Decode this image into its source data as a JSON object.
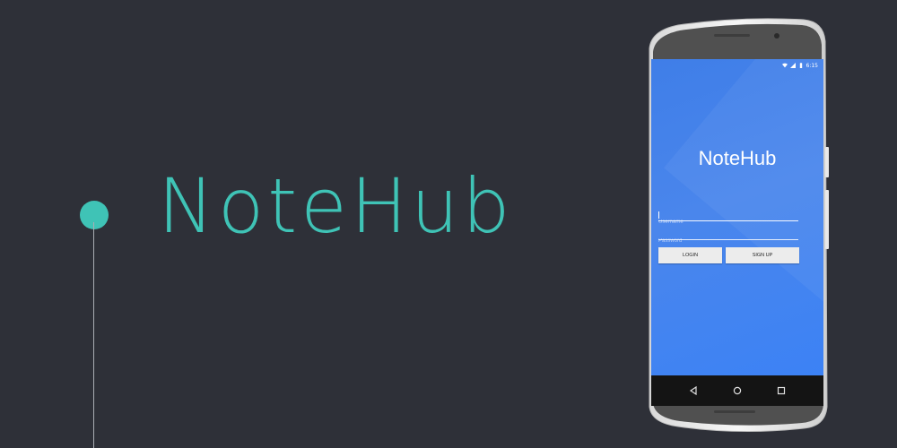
{
  "brand": {
    "title": "NoteHub",
    "accent_color": "#3fc3b6",
    "background_color": "#2e3038"
  },
  "phone": {
    "status_bar": {
      "icons": [
        "wifi-icon",
        "signal-icon",
        "battery-icon"
      ],
      "time": "6:15"
    },
    "app": {
      "title": "NoteHub",
      "username_placeholder": "Username",
      "password_placeholder": "Password",
      "login_label": "LOGIN",
      "signup_label": "SIGN UP",
      "screen_color": "#3f7ee8"
    },
    "nav_bar": {
      "icons": [
        "back-icon",
        "home-icon",
        "recents-icon"
      ]
    }
  }
}
